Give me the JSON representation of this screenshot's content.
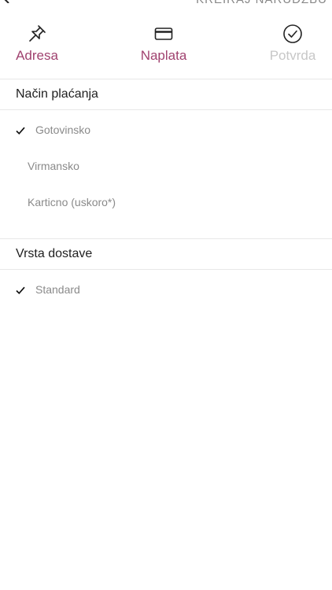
{
  "header": {
    "title": "KREIRAJ NARUDŽBU"
  },
  "steps": [
    {
      "label": "Adresa",
      "icon": "pin-icon",
      "state": "active"
    },
    {
      "label": "Naplata",
      "icon": "credit-card-icon",
      "state": "active"
    },
    {
      "label": "Potvrda",
      "icon": "check-circle-icon",
      "state": "inactive"
    }
  ],
  "payment": {
    "title": "Način plaćanja",
    "options": [
      {
        "label": "Gotovinsko",
        "selected": true
      },
      {
        "label": "Virmansko",
        "selected": false
      },
      {
        "label": "Karticno (uskoro*)",
        "selected": false
      }
    ]
  },
  "delivery": {
    "title": "Vrsta dostave",
    "options": [
      {
        "label": "Standard",
        "selected": true
      }
    ]
  },
  "colors": {
    "accent": "#a0426f",
    "inactive": "#c7c7c7",
    "option_text": "#8a8a8a",
    "divider": "#e8e8e8"
  }
}
